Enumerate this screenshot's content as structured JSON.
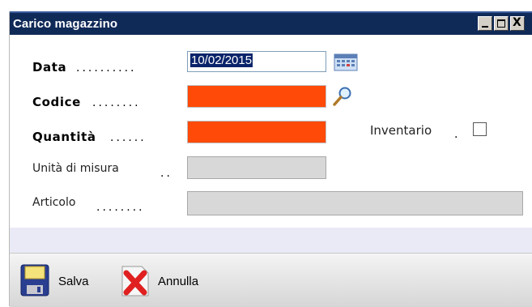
{
  "window": {
    "title": "Carico magazzino",
    "controls": {
      "minimize": "_",
      "maximize": "□",
      "close": "X"
    }
  },
  "form": {
    "data": {
      "label": "Data",
      "dots": "..........",
      "value": "10/02/2015"
    },
    "codice": {
      "label": "Codice",
      "dots": "........",
      "value": ""
    },
    "quantita": {
      "label": "Quantità",
      "dots": "......",
      "value": ""
    },
    "unita": {
      "label": "Unità di misura",
      "dots": "..",
      "value": ""
    },
    "articolo": {
      "label": "Articolo",
      "dots": "........",
      "value": ""
    },
    "inventario": {
      "label": "Inventario",
      "dot": ".",
      "checked": false
    }
  },
  "toolbar": {
    "save_label": "Salva",
    "cancel_label": "Annulla"
  },
  "colors": {
    "titlebar": "#102a58",
    "required_field": "#ff4a08",
    "readonly_field": "#d8d8d8",
    "band": "#e9eaf6"
  },
  "icons": {
    "calendar": "calendar-icon",
    "search": "magnifier-icon",
    "save": "floppy-disk-icon",
    "cancel": "cancel-x-icon"
  }
}
